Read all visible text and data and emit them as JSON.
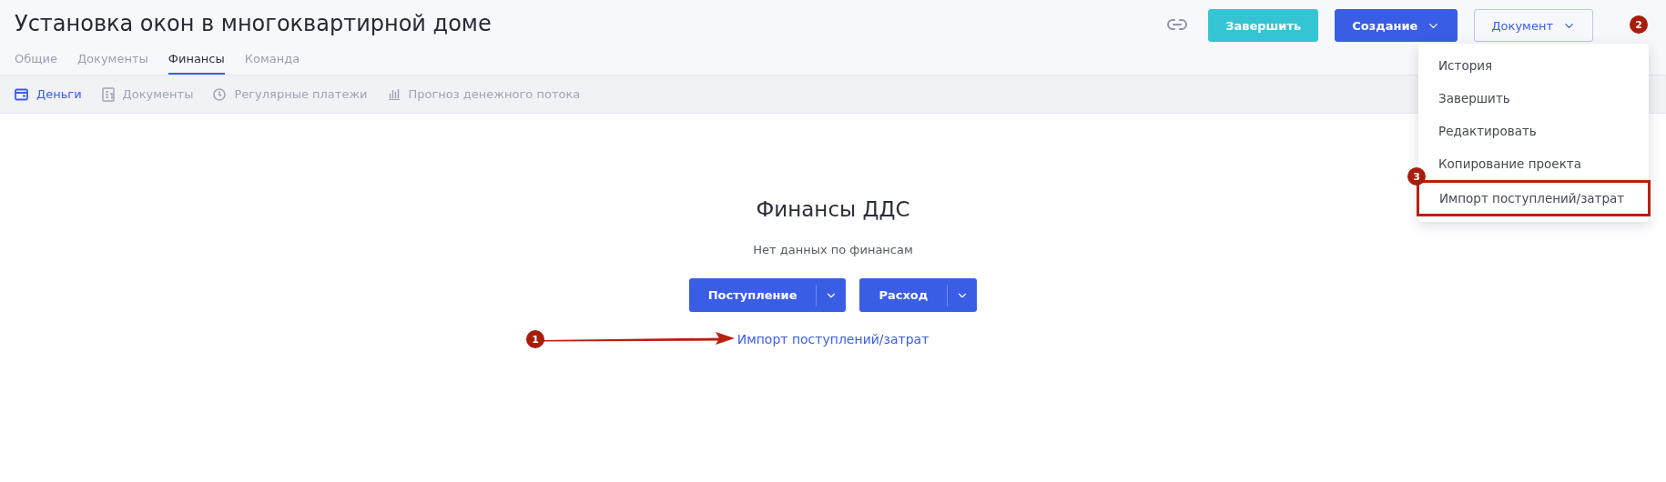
{
  "page": {
    "title": "Установка окон в многоквартирной доме"
  },
  "tabs": [
    {
      "label": "Общие",
      "selected": false
    },
    {
      "label": "Документы",
      "selected": false
    },
    {
      "label": "Финансы",
      "selected": true
    },
    {
      "label": "Команда",
      "selected": false
    }
  ],
  "header_actions": {
    "finish": "Завершить",
    "create": "Создание",
    "document": "Документ"
  },
  "subtabs": [
    {
      "label": "Деньги",
      "selected": true
    },
    {
      "label": "Документы",
      "selected": false
    },
    {
      "label": "Регулярные платежи",
      "selected": false
    },
    {
      "label": "Прогноз денежного потока",
      "selected": false
    }
  ],
  "menu": {
    "items": [
      {
        "label": "История",
        "outlined": false
      },
      {
        "label": "Завершить",
        "outlined": false
      },
      {
        "label": "Редактировать",
        "outlined": false
      },
      {
        "label": "Копирование проекта",
        "outlined": false
      },
      {
        "label": "Импорт поступлений/затрат",
        "outlined": true
      }
    ]
  },
  "empty_state": {
    "title": "Финансы ДДС",
    "message": "Нет данных по финансам",
    "buttons": [
      "Поступление",
      "Расход"
    ],
    "link": "Импорт поступлений/затрат"
  },
  "annotations": [
    {
      "text": "1",
      "arrow": true
    },
    {
      "text": "2",
      "arrow": false
    },
    {
      "text": "3",
      "arrow": false
    }
  ]
}
